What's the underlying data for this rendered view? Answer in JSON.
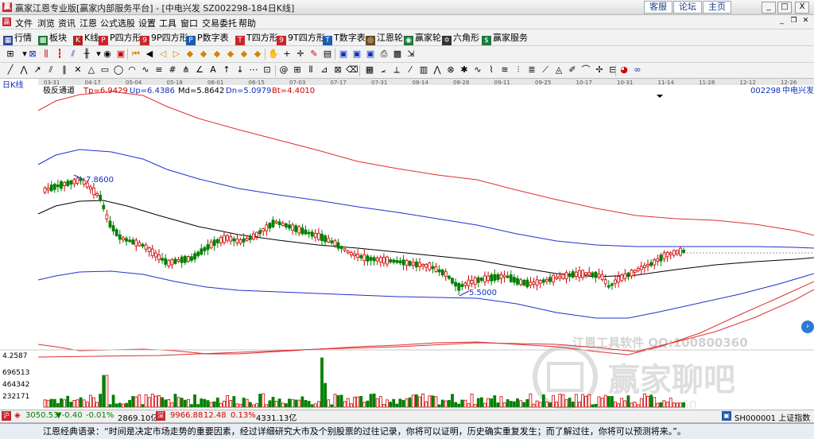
{
  "window": {
    "title": "赢家江恩专业版[赢家内部服务平台] - [中电兴发  SZ002298-184日K线]",
    "quick_links": [
      "客服",
      "论坛",
      "主页"
    ],
    "controls": [
      "_",
      "□",
      "X"
    ]
  },
  "menu": [
    "文件",
    "浏览",
    "资讯",
    "江恩",
    "公式选股",
    "设置",
    "工具",
    "窗口",
    "交易委托",
    "帮助"
  ],
  "nav_buttons": [
    {
      "label": "行情",
      "icon": "grid-icon",
      "glyph": "▦",
      "color": "#2c4b9a"
    },
    {
      "label": "板块",
      "icon": "blocks-icon",
      "glyph": "▩",
      "color": "#1c7a3a"
    },
    {
      "label": "K线",
      "icon": "candlestick-icon",
      "glyph": "K",
      "color": "#b22222"
    },
    {
      "label": "P四方形",
      "icon": "p-square-icon",
      "glyph": "P",
      "color": "#c8262c"
    },
    {
      "label": "9P四方形",
      "icon": "9p-square-icon",
      "glyph": "9",
      "color": "#c8262c"
    },
    {
      "label": "P数字表",
      "icon": "p-table-icon",
      "glyph": "P",
      "color": "#1c5bb0"
    },
    {
      "label": "T四方形",
      "icon": "t-square-icon",
      "glyph": "T",
      "color": "#c8262c"
    },
    {
      "label": "9T四方形",
      "icon": "9t-square-icon",
      "glyph": "9",
      "color": "#c8262c"
    },
    {
      "label": "T数字表",
      "icon": "t-table-icon",
      "glyph": "T",
      "color": "#1c5bb0"
    },
    {
      "label": "江恩轮",
      "icon": "gann-wheel-icon",
      "glyph": "◎",
      "color": "#6b4a1a"
    },
    {
      "label": "赢家轮",
      "icon": "winner-wheel-icon",
      "glyph": "◉",
      "color": "#1c7a3a"
    },
    {
      "label": "六角形",
      "icon": "hexagon-icon",
      "glyph": "✡",
      "color": "#333333"
    },
    {
      "label": "赢家服务",
      "icon": "service-icon",
      "glyph": "$",
      "color": "#1c7a3a"
    }
  ],
  "chart": {
    "period_label": "日K线",
    "indicator_name": "极反通道",
    "indicator_values": [
      {
        "text": "Tp=6.9429",
        "color": "#d00000"
      },
      {
        "text": "Up=6.4386",
        "color": "#1030c0"
      },
      {
        "text": "Md=5.8642",
        "color": "#000000"
      },
      {
        "text": "Dn=5.0979",
        "color": "#1030c0"
      },
      {
        "text": "Bt=4.4010",
        "color": "#d00000"
      }
    ],
    "stock_code": "002298",
    "stock_name": "中电兴发",
    "date_ticks": [
      "03-31",
      "04-17",
      "05-04",
      "05-18",
      "06-01",
      "06-15",
      "07-03",
      "07-17",
      "07-31",
      "08-14",
      "08-28",
      "09-11",
      "09-25",
      "10-17",
      "10-31",
      "11-14",
      "11-28",
      "12-12",
      "12-26"
    ],
    "high_marker": "7.8600",
    "low_marker": "5.5000",
    "volume_axis": [
      "4.2587",
      "696513",
      "464342",
      "232171"
    ],
    "watermark": {
      "line1": "江恩工具软件  QQ:100800360",
      "logo_text": "赢家聊吧",
      "site": "liaoba.win360"
    }
  },
  "status": {
    "sh_index": "3050.53",
    "sh_change": "▼-0.40",
    "sh_pct": "-0.01%",
    "sh_amount": "2869.10亿",
    "sz_index": "9966.88",
    "sz_change": "12.48",
    "sz_pct": "0.13%",
    "sz_amount": "4331.13亿",
    "right_index": "SH000001 上证指数"
  },
  "quote": "江恩经典语录：“时间是决定市场走势的重要因素，经过详细研究大市及个别股票的过往记录，你将可以证明，历史确实重复发生；而了解过往，你将可以预测将来。”。"
}
